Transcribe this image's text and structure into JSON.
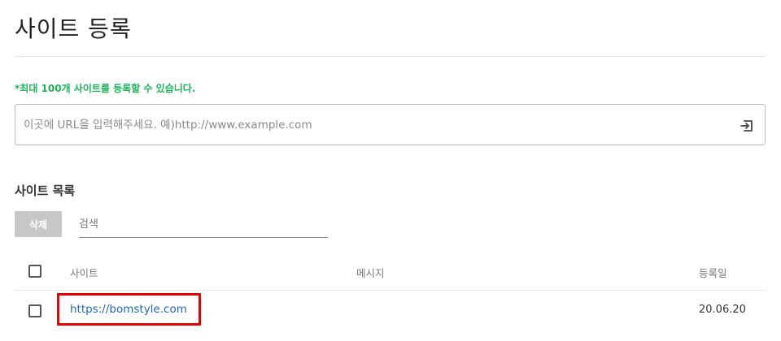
{
  "page": {
    "title": "사이트 등록"
  },
  "register": {
    "notice": "*최대 100개 사이트를 등록할 수 있습니다.",
    "url_placeholder": "이곳에 URL을 입력해주세요. 예)http://www.example.com",
    "url_value": "",
    "submit_icon": "login-arrow-icon"
  },
  "list": {
    "title": "사이트 목록",
    "delete_label": "삭제",
    "search_placeholder": "검색",
    "columns": {
      "site": "사이트",
      "message": "메시지",
      "date": "등록일"
    },
    "rows": [
      {
        "site": "https://bomstyle.com",
        "message": "",
        "date": "20.06.20",
        "highlighted": true
      }
    ]
  },
  "colors": {
    "notice_green": "#1fb35c",
    "link_blue": "#1f66b5",
    "highlight_red": "#e60000",
    "disabled_button": "#c7c7c7"
  }
}
